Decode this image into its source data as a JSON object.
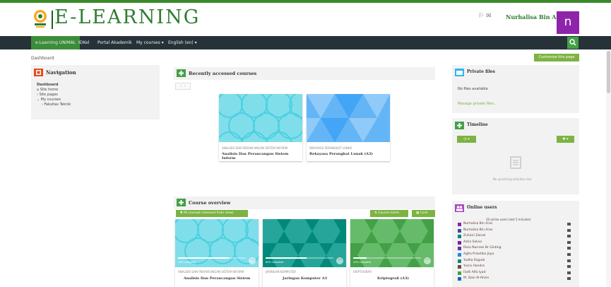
{
  "header": {
    "brand": "E-LEARNING",
    "user_name": "Nurhalisa Bin Aras",
    "avatar_letter": "n",
    "icons": [
      "bell-icon",
      "message-icon"
    ]
  },
  "navbar": {
    "items": [
      "e-Learning UNIMAL",
      "IDKel",
      "Portal Akademik",
      "My courses",
      "English (en)"
    ]
  },
  "breadcrumb": "Dashboard",
  "customise_label": "Customise this page",
  "navigation": {
    "title": "Navigation",
    "items": [
      "Dashboard",
      "Site home",
      "Site pages",
      "My courses",
      "Fakultas Teknik"
    ]
  },
  "recent": {
    "title": "Recently accessed courses",
    "courses": [
      {
        "category": "ANALISIS DAN PERANCANGAN SISTEM INFORM",
        "title": "Analisis Dan Perancangan Sistem Inform"
      },
      {
        "category": "REKAYASA PERANGKAT LUNAK",
        "title": "Rekayasa Perangkat Lunak (A3)"
      }
    ]
  },
  "overview": {
    "title": "Course overview",
    "filter_label": "All (except removed from view)",
    "sort_label": "Course name",
    "view_label": "Card",
    "courses": [
      {
        "category": "ANALISIS DAN PERANCANGAN SISTEM INFORM",
        "title": "Analisis Dan Perancangan Sistem",
        "progress": 0.75,
        "progress_label": "75% complete"
      },
      {
        "category": "JARINGAN KOMPUTER",
        "title": "Jaringan Komputer A3",
        "progress": 0.6,
        "progress_label": "60% complete"
      },
      {
        "category": "KRIPTOGRAFI",
        "title": "Kriptografi (A3)",
        "progress": 0.2,
        "progress_label": "20% complete"
      }
    ]
  },
  "private_files": {
    "title": "Private files",
    "empty": "No files available",
    "manage": "Manage private files..."
  },
  "timeline": {
    "title": "Timeline",
    "empty": "No upcoming activities due"
  },
  "online": {
    "title": "Online users",
    "summary": "10 online users (last 5 minutes)",
    "users": [
      {
        "name": "Nurhalisa Bin Aras",
        "color": "#8e24aa"
      },
      {
        "name": "Nurhalisa Bin Aras",
        "color": "#3949ab"
      },
      {
        "name": "Zuhairi Zainal",
        "color": "#00897b"
      },
      {
        "name": "Asha Salvia",
        "color": "#7b1fa2"
      },
      {
        "name": "Rosa Nurnasi Br Ginting",
        "color": "#5e35b1"
      },
      {
        "name": "Agita Priastika Jaya",
        "color": "#1e88e5"
      },
      {
        "name": "Yudha Rajpah",
        "color": "#00897b"
      },
      {
        "name": "Yusra Hendra",
        "color": "#6d4c41"
      },
      {
        "name": "Fadli Alfa Iyad",
        "color": "#43a047"
      },
      {
        "name": "M. Qasi Al-Ahsin",
        "color": "#1565c0"
      }
    ]
  }
}
